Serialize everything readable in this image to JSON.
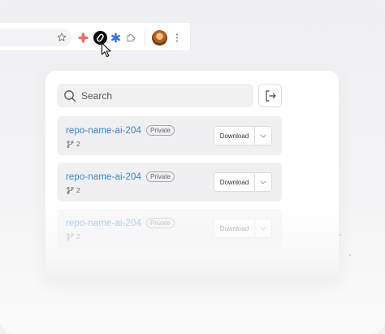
{
  "toolbar": {
    "icons": [
      "star-icon",
      "red-asterisk-extension-icon",
      "active-extension-icon",
      "blue-asterisk-extension-icon",
      "puzzle-extensions-icon",
      "profile-avatar",
      "more-menu-icon"
    ]
  },
  "popup": {
    "search": {
      "placeholder": "Search",
      "value": ""
    },
    "logout_icon": "logout-icon",
    "repos": [
      {
        "name": "repo-name-ai-204",
        "visibility": "Private",
        "branches": "2",
        "download_label": "Download"
      },
      {
        "name": "repo-name-ai-204",
        "visibility": "Private",
        "branches": "2",
        "download_label": "Download"
      },
      {
        "name": "repo-name-ai-204",
        "visibility": "Private",
        "branches": "2",
        "download_label": "Download"
      }
    ]
  },
  "colors": {
    "accent_link": "#3b82d4",
    "card_bg": "#f0f0f2",
    "extension_red": "#ef6a6a",
    "extension_blue": "#3b6fe0"
  }
}
